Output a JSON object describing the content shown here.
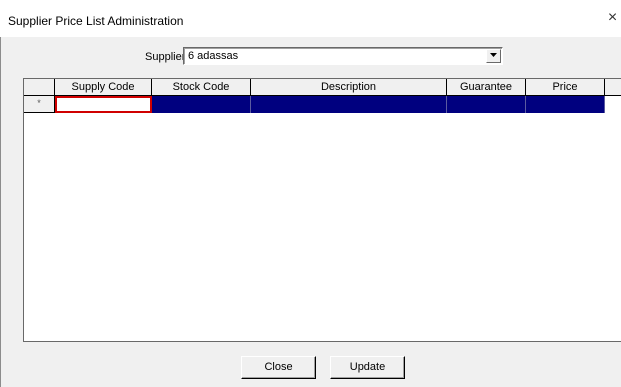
{
  "window": {
    "title": "Supplier Price List Administration",
    "close_glyph": "×"
  },
  "supplier": {
    "label": "Supplier",
    "selected": "6 adassas"
  },
  "grid": {
    "columns": [
      "Supply Code",
      "Stock Code",
      "Description",
      "Guarantee",
      "Price"
    ],
    "new_row_marker": "*",
    "selection_color": "#00007f",
    "current_cell_border_color": "#d00000"
  },
  "buttons": {
    "close": "Close",
    "update": "Update"
  }
}
